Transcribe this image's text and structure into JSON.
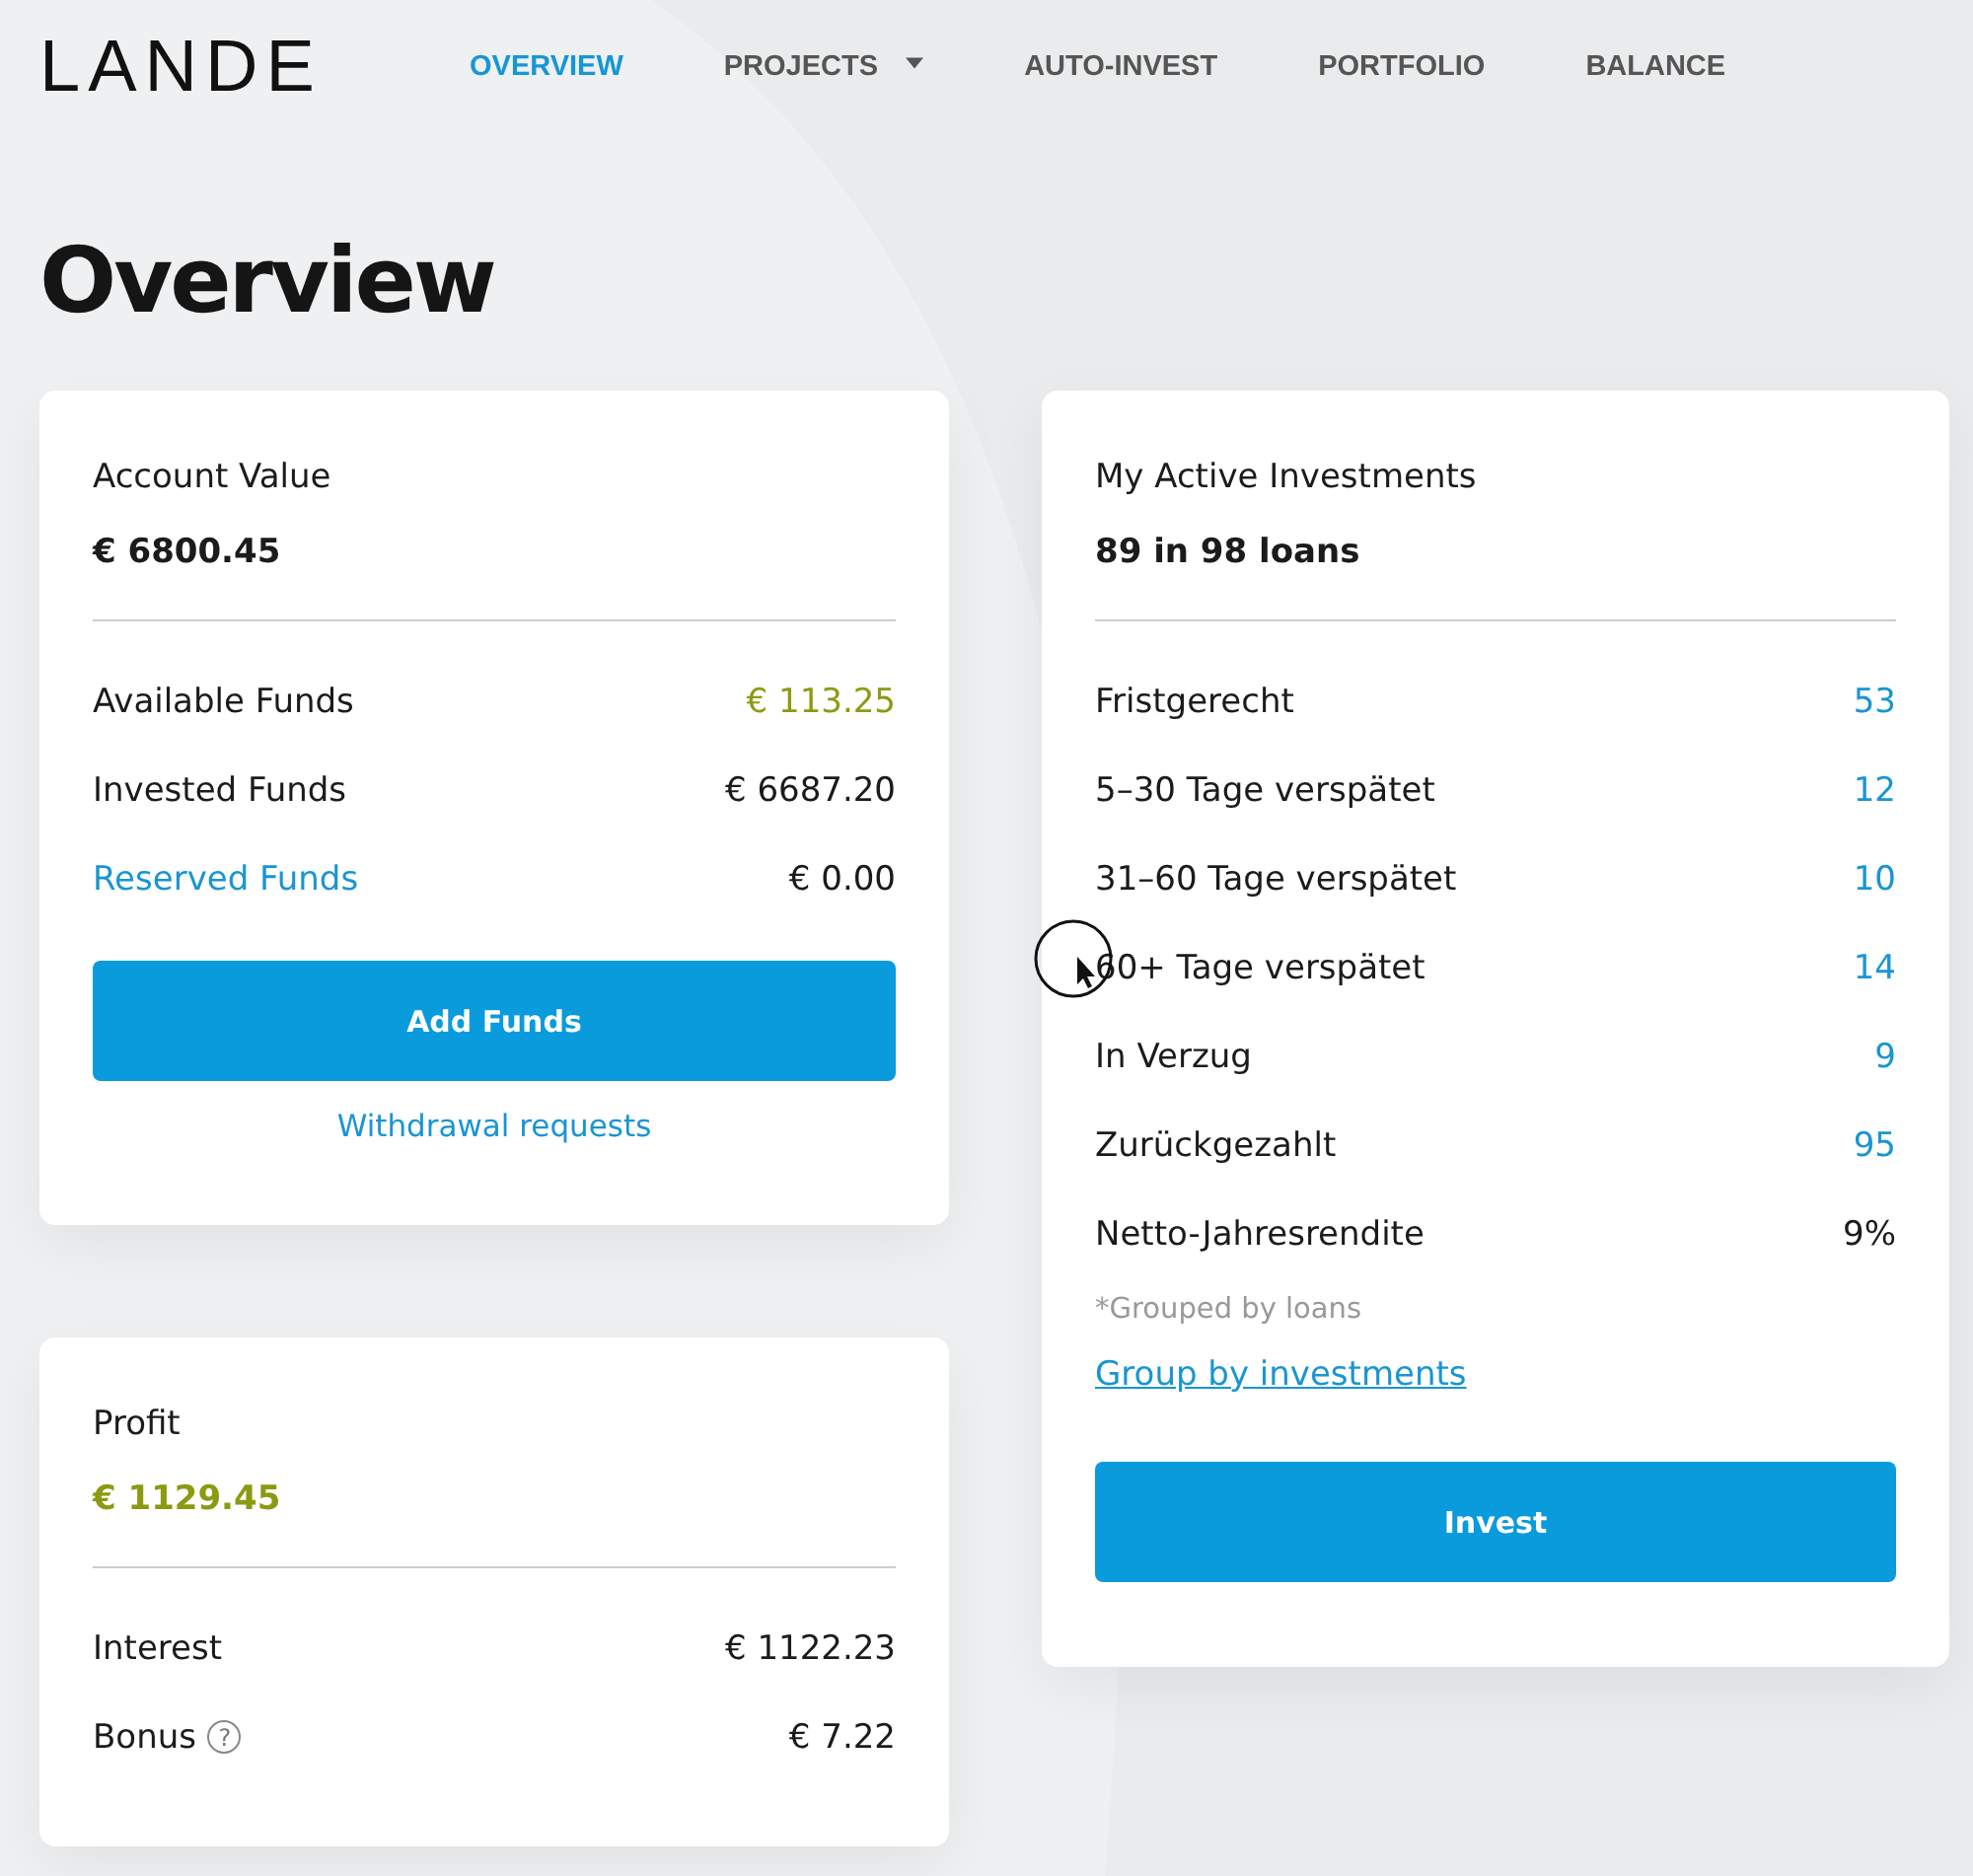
{
  "logo": "LANDE",
  "nav": [
    {
      "label": "OVERVIEW",
      "selected": true,
      "has_menu": false
    },
    {
      "label": "PROJECTS",
      "selected": false,
      "has_menu": true
    },
    {
      "label": "AUTO-INVEST",
      "selected": false,
      "has_menu": false
    },
    {
      "label": "PORTFOLIO",
      "selected": false,
      "has_menu": false
    },
    {
      "label": "BALANCE",
      "selected": false,
      "has_menu": false
    }
  ],
  "heading": "Overview",
  "account": {
    "title": "Account Value",
    "value": "€ 6800.45",
    "rows": [
      {
        "label": "Available Funds",
        "value": "€ 113.25",
        "kind": "positive"
      },
      {
        "label": "Invested Funds",
        "value": "€ 6687.20",
        "kind": "plain"
      },
      {
        "label": "Reserved Funds",
        "value": "€ 0.00",
        "kind": "label-link"
      }
    ],
    "button": "Add Funds",
    "link": "Withdrawal requests"
  },
  "profit": {
    "title": "Profit",
    "value": "€ 1129.45",
    "rows": [
      {
        "label": "Interest",
        "value": "€ 1122.23",
        "kind": "plain"
      },
      {
        "label": "Bonus",
        "value": "€ 7.22",
        "kind": "help",
        "help": "?"
      }
    ]
  },
  "investments": {
    "title": "My Active Investments",
    "value": "89 in 98 loans",
    "rows": [
      {
        "label": "Fristgerecht",
        "value": "53",
        "kind": "value-link"
      },
      {
        "label": "5–30 Tage verspätet",
        "value": "12",
        "kind": "value-link"
      },
      {
        "label": "31–60 Tage verspätet",
        "value": "10",
        "kind": "value-link"
      },
      {
        "label": "60+ Tage verspätet",
        "value": "14",
        "kind": "value-link"
      },
      {
        "label": "In Verzug",
        "value": "9",
        "kind": "value-link"
      },
      {
        "label": "Zurückgezahlt",
        "value": "95",
        "kind": "value-link"
      },
      {
        "label": "Netto-Jahresrendite",
        "value": "9%",
        "kind": "plain"
      }
    ],
    "note": "*Grouped by loans",
    "link": "Group by investments",
    "button": "Invest"
  }
}
